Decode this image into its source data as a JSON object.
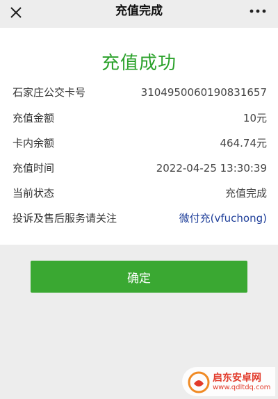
{
  "header": {
    "title": "充值完成",
    "close_icon": "close-icon",
    "more_icon": "more-dots-icon"
  },
  "result": {
    "title": "充值成功",
    "rows": [
      {
        "label": "石家庄公交卡号",
        "value": "3104950060190831657"
      },
      {
        "label": "充值金额",
        "value": "10元"
      },
      {
        "label": "卡内余额",
        "value": "464.74元"
      },
      {
        "label": "充值时间",
        "value": "2022-04-25 13:30:39"
      },
      {
        "label": "当前状态",
        "value": "充值完成"
      },
      {
        "label": "投诉及售后服务请关注",
        "value": "微付充(vfuchong)"
      }
    ]
  },
  "actions": {
    "confirm_label": "确定"
  },
  "watermark": {
    "name": "启东安卓网",
    "url": "www.qdltdq.com"
  },
  "colors": {
    "success_green": "#2aa12a",
    "button_green": "#3aa832",
    "link_blue": "#1f3f9a",
    "background": "#ededed",
    "watermark_red": "#e23a2a"
  }
}
